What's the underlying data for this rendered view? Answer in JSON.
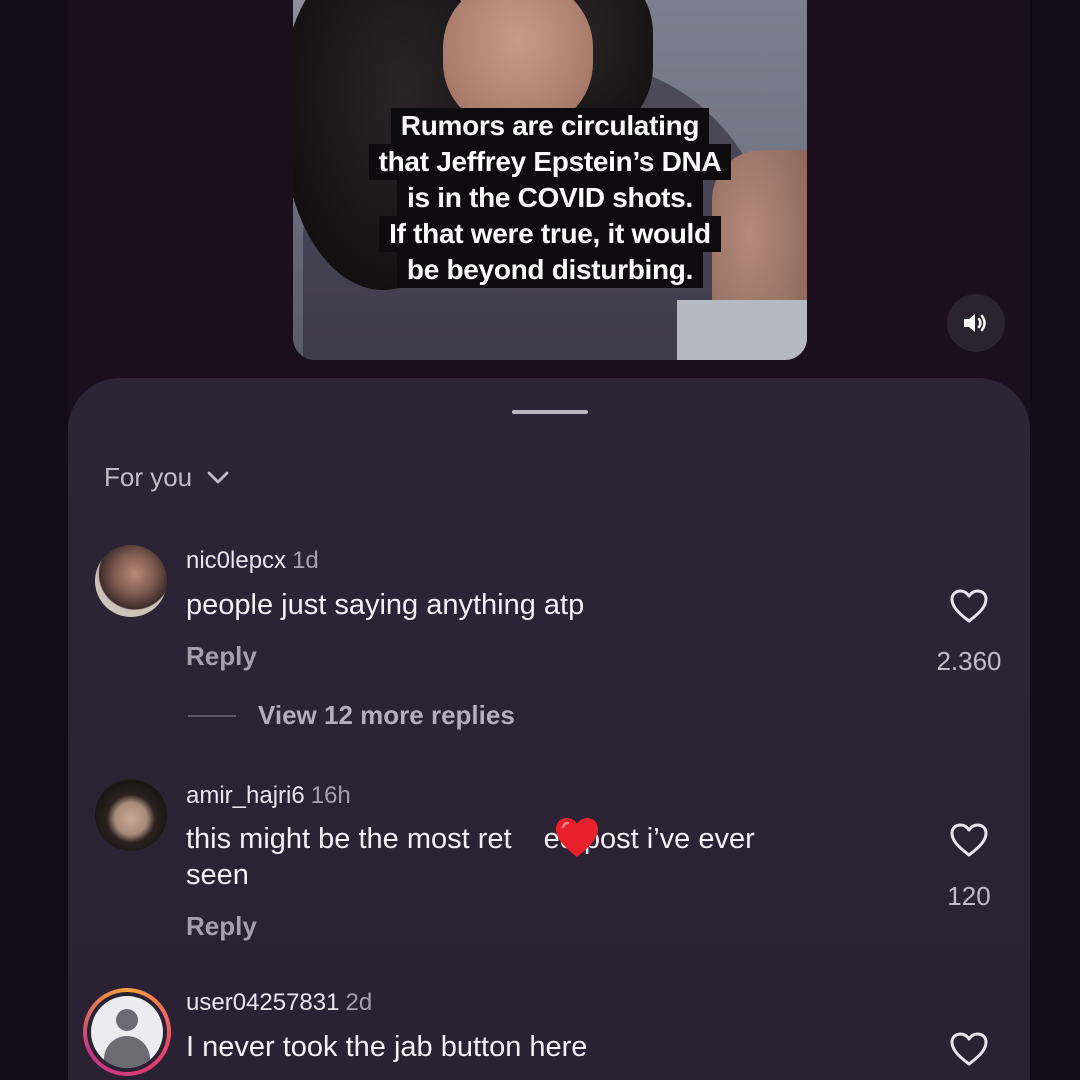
{
  "video": {
    "caption_lines": [
      "Rumors are circulating",
      "that Jeffrey Epstein’s DNA",
      "is in the COVID shots.",
      "If that were true, it would",
      "be beyond disturbing."
    ],
    "sound_icon": "speaker-icon"
  },
  "comments_sheet": {
    "filter_label": "For you",
    "comments": [
      {
        "username": "nic0lepcx",
        "time": "1d",
        "text": "people just saying anything atp",
        "reply_label": "Reply",
        "likes": "2.360",
        "view_more": "View 12 more replies"
      },
      {
        "username": "amir_hajri6",
        "time": "16h",
        "text_before": "this might be the most ret",
        "text_after": "ed post i’ve ever",
        "text_line2": "seen",
        "reply_label": "Reply",
        "likes": "120"
      },
      {
        "username": "user04257831",
        "time": "2d",
        "text": "I never took the jab button here"
      }
    ]
  },
  "colors": {
    "background": "#150a17",
    "sheet": "#2d2437",
    "heart_emoji": "#e8202c"
  }
}
